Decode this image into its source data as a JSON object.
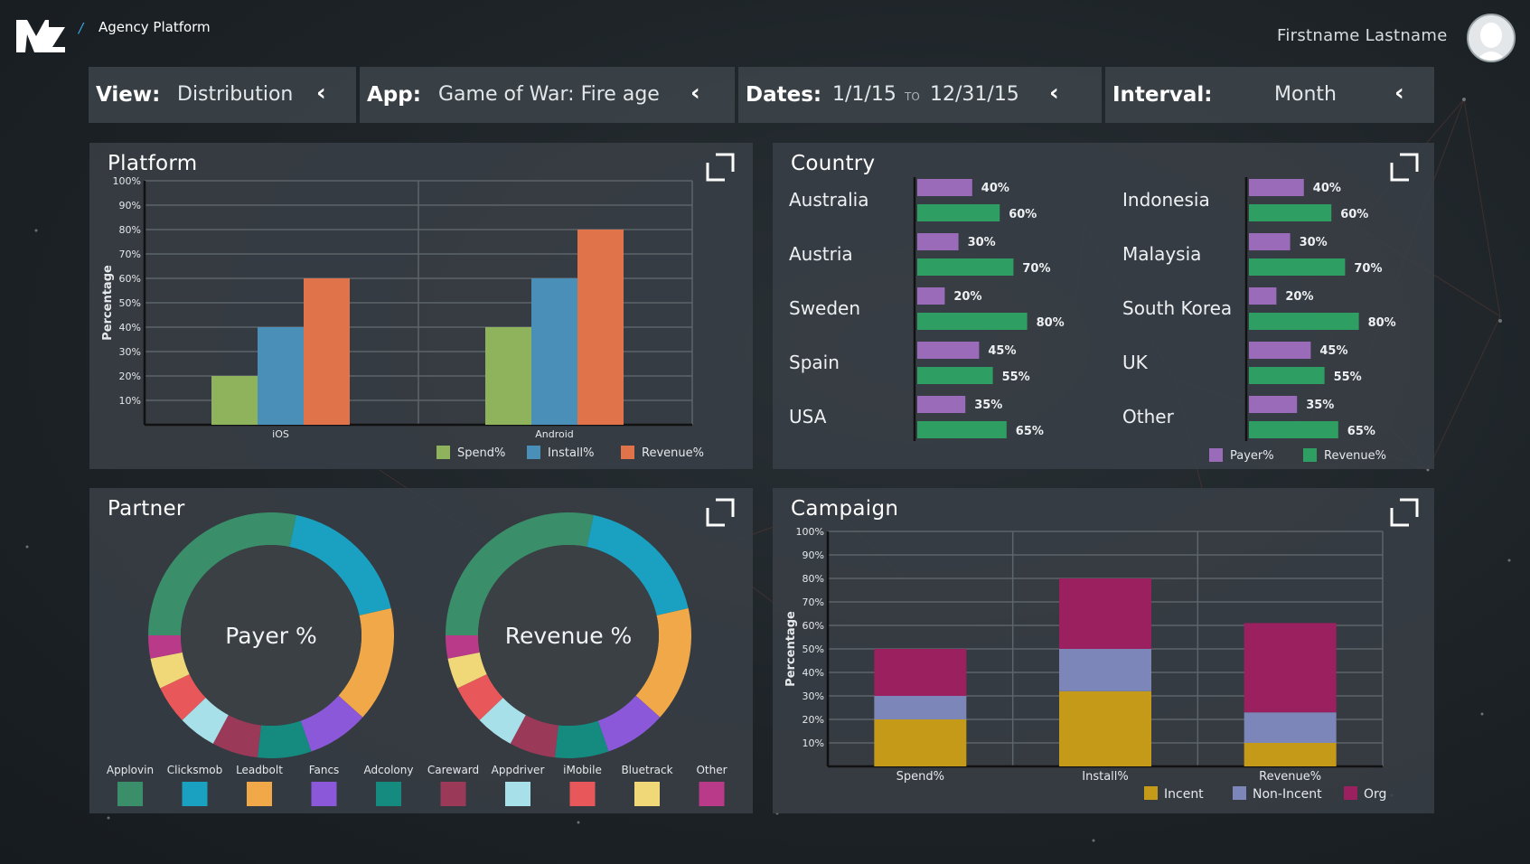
{
  "header": {
    "breadcrumb": "Agency Platform",
    "user_name": "Firstname Lastname"
  },
  "filters": {
    "view": {
      "label": "View:",
      "value": "Distribution"
    },
    "app": {
      "label": "App:",
      "value": "Game of War: Fire age"
    },
    "dates": {
      "label": "Dates:",
      "start": "1/1/15",
      "to": "TO",
      "end": "12/31/15"
    },
    "interval": {
      "label": "Interval:",
      "value": "Month"
    }
  },
  "panels": {
    "platform": "Platform",
    "country": "Country",
    "partner": "Partner",
    "campaign": "Campaign"
  },
  "colors": {
    "spend": "#8fb35c",
    "install": "#4a8fb8",
    "revenue": "#e0734a",
    "payer": "#9a6bb8",
    "revenue_green": "#2e9e62",
    "incent": "#c49a18",
    "nonincent": "#7d86b8",
    "org": "#9b2060"
  },
  "chart_data": [
    {
      "id": "platform",
      "type": "bar",
      "ylabel": "Percentage",
      "ylim": [
        0,
        100
      ],
      "yticks": [
        "100%",
        "90%",
        "80%",
        "70%",
        "60%",
        "50%",
        "40%",
        "30%",
        "20%",
        "10%"
      ],
      "categories": [
        "iOS",
        "Android"
      ],
      "series": [
        {
          "name": "Spend%",
          "values": [
            20,
            40
          ]
        },
        {
          "name": "Install%",
          "values": [
            40,
            60
          ]
        },
        {
          "name": "Revenue%",
          "values": [
            60,
            80
          ]
        }
      ],
      "legend": "bottom-right",
      "grid": true
    },
    {
      "id": "country",
      "type": "bar",
      "orientation": "horizontal",
      "groups": [
        {
          "countries": [
            "Australia",
            "Austria",
            "Sweden",
            "Spain",
            "USA"
          ],
          "payer": [
            40,
            30,
            20,
            45,
            35
          ],
          "revenue": [
            60,
            70,
            80,
            55,
            65
          ]
        },
        {
          "countries": [
            "Indonesia",
            "Malaysia",
            "South Korea",
            "UK",
            "Other"
          ],
          "payer": [
            40,
            30,
            20,
            45,
            35
          ],
          "revenue": [
            60,
            70,
            80,
            55,
            65
          ]
        }
      ],
      "series_names": [
        "Payer%",
        "Revenue%"
      ],
      "legend": "bottom-right"
    },
    {
      "id": "partner",
      "type": "pie",
      "charts": [
        {
          "center_label": "Payer %",
          "slices": [
            {
              "name": "Applovin",
              "value": 28
            },
            {
              "name": "Clicksmob",
              "value": 18
            },
            {
              "name": "Leadbolt",
              "value": 15
            },
            {
              "name": "Fancs",
              "value": 8
            },
            {
              "name": "Adcolony",
              "value": 7
            },
            {
              "name": "Careward",
              "value": 6
            },
            {
              "name": "Appdriver",
              "value": 5
            },
            {
              "name": "iMobile",
              "value": 5
            },
            {
              "name": "Bluetrack",
              "value": 4
            },
            {
              "name": "Other",
              "value": 3
            }
          ]
        },
        {
          "center_label": "Revenue %",
          "slices": [
            {
              "name": "Applovin",
              "value": 28
            },
            {
              "name": "Clicksmob",
              "value": 18
            },
            {
              "name": "Leadbolt",
              "value": 15
            },
            {
              "name": "Fancs",
              "value": 8
            },
            {
              "name": "Adcolony",
              "value": 7
            },
            {
              "name": "Careward",
              "value": 6
            },
            {
              "name": "Appdriver",
              "value": 5
            },
            {
              "name": "iMobile",
              "value": 5
            },
            {
              "name": "Bluetrack",
              "value": 4
            },
            {
              "name": "Other",
              "value": 3
            }
          ]
        }
      ],
      "legend": [
        {
          "name": "Applovin",
          "color": "#3a8f6a"
        },
        {
          "name": "Clicksmob",
          "color": "#1aa0c0"
        },
        {
          "name": "Leadbolt",
          "color": "#f0a848"
        },
        {
          "name": "Fancs",
          "color": "#8a58d8"
        },
        {
          "name": "Adcolony",
          "color": "#158b80"
        },
        {
          "name": "Careward",
          "color": "#9a3a58"
        },
        {
          "name": "Appdriver",
          "color": "#a8e0ea"
        },
        {
          "name": "iMobile",
          "color": "#e8585a"
        },
        {
          "name": "Bluetrack",
          "color": "#f0d878"
        },
        {
          "name": "Other",
          "color": "#b83a88"
        }
      ]
    },
    {
      "id": "campaign",
      "type": "bar",
      "stacked": true,
      "ylabel": "Percentage",
      "ylim": [
        0,
        100
      ],
      "yticks": [
        "100%",
        "90%",
        "80%",
        "70%",
        "60%",
        "50%",
        "40%",
        "30%",
        "20%",
        "10%"
      ],
      "categories": [
        "Spend%",
        "Install%",
        "Revenue%"
      ],
      "series": [
        {
          "name": "Incent",
          "values": [
            20,
            32,
            10
          ]
        },
        {
          "name": "Non-Incent",
          "values": [
            10,
            18,
            13
          ]
        },
        {
          "name": "Org",
          "values": [
            20,
            30,
            38
          ]
        }
      ],
      "legend": "bottom-right",
      "grid": true
    }
  ]
}
